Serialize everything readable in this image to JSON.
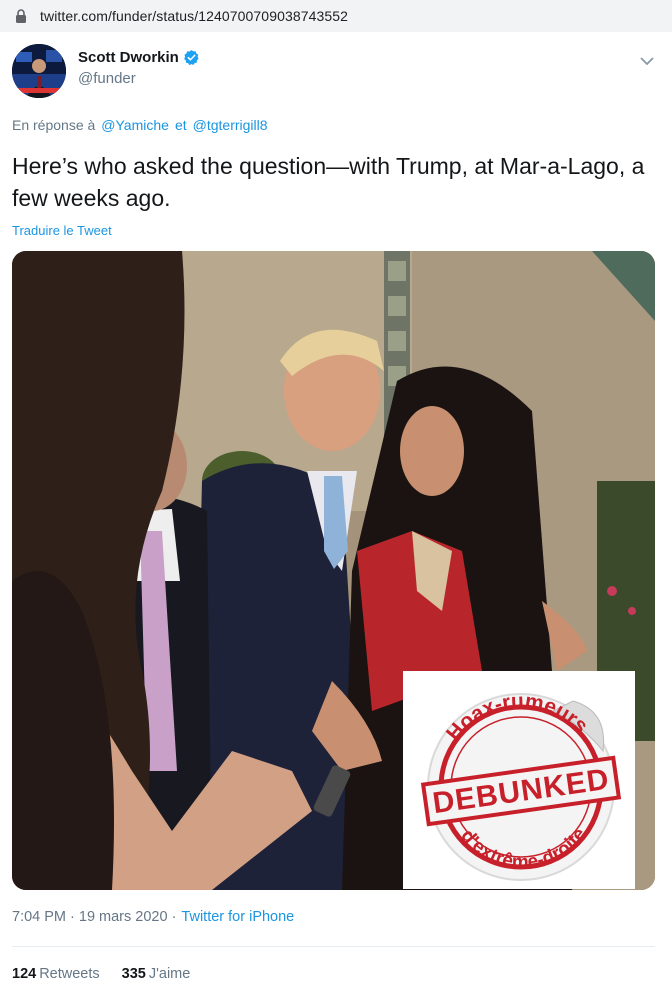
{
  "browser": {
    "url": "twitter.com/funder/status/1240700709038743552"
  },
  "tweet": {
    "author_name": "Scott Dworkin",
    "handle": "@funder",
    "reply_prefix": "En réponse à",
    "reply_mentions": [
      "@Yamiche",
      "et",
      "@tgterrigill8"
    ],
    "text": "Here’s who asked the question—with Trump, at Mar-a-Lago, a few weeks ago.",
    "translate_label": "Traduire le Tweet",
    "timestamp": "7:04 PM · 19 mars 2020 ·",
    "source": "Twitter for iPhone",
    "retweets_count": "124",
    "retweets_label": "Retweets",
    "likes_count": "335",
    "likes_label": "J'aime"
  },
  "stamp": {
    "top_text": "Hoax-rumeurs",
    "center_text": "DEBUNKED",
    "bottom_text": "d'extrême-droite"
  },
  "colors": {
    "link_blue": "#1b95e0",
    "verified_blue": "#1da1f2",
    "stamp_red": "#c8202a"
  },
  "icons": [
    "lock-icon",
    "verified-badge-icon",
    "chevron-down-icon"
  ]
}
